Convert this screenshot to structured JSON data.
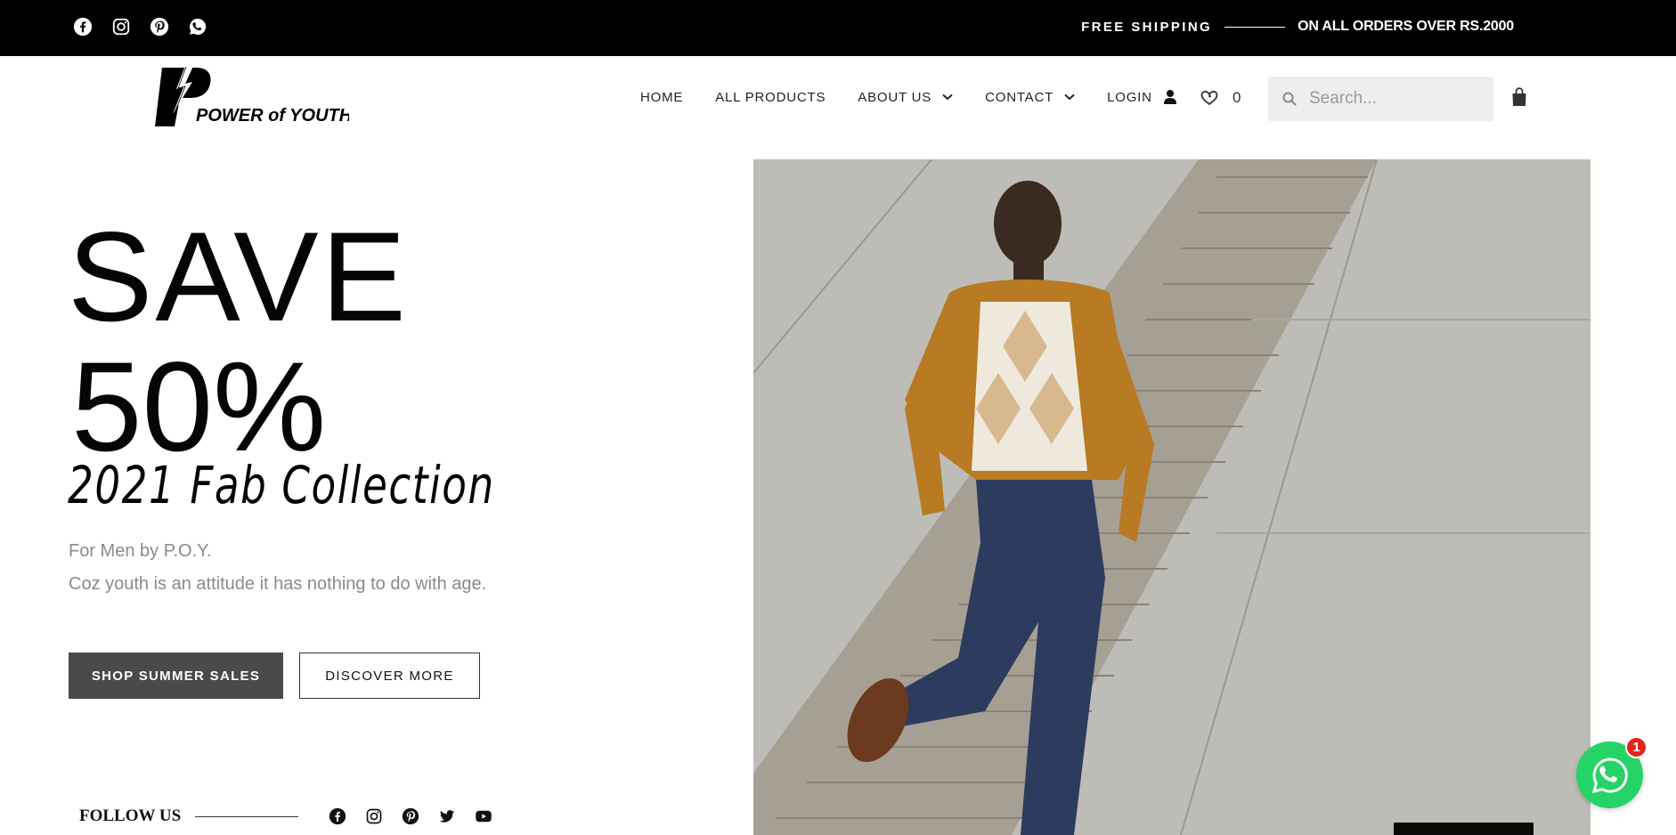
{
  "topbar": {
    "socials": [
      "facebook-icon",
      "instagram-icon",
      "pinterest-icon",
      "whatsapp-icon"
    ],
    "free_shipping": "FREE SHIPPING",
    "orders_text": "ON ALL ORDERS OVER RS.2000"
  },
  "header": {
    "logo_text": "POWER of YOUTH",
    "nav": {
      "home": "HOME",
      "all_products": "ALL PRODUCTS",
      "about_us": "ABOUT US",
      "contact": "CONTACT",
      "login": "LOGIN"
    },
    "wishlist_count": "0",
    "search_placeholder": "Search..."
  },
  "hero": {
    "save": "SAVE",
    "percent": "50%",
    "collection": "2021 Fab Collection",
    "line1": "For Men by P.O.Y.",
    "line2": "Coz youth is an attitude it has nothing to do with age.",
    "shop_button": "SHOP SUMMER SALES",
    "discover_button": "DISCOVER MORE"
  },
  "follow": {
    "label": "FOLLOW US",
    "icons": [
      "facebook-icon",
      "instagram-icon",
      "pinterest-icon",
      "twitter-icon",
      "youtube-icon"
    ]
  },
  "whatsapp": {
    "badge": "1"
  },
  "colors": {
    "topbar_bg": "#000000",
    "shop_button_bg": "#4a4a4a",
    "whatsapp_green": "#25d366",
    "badge_red": "#e2241b"
  }
}
